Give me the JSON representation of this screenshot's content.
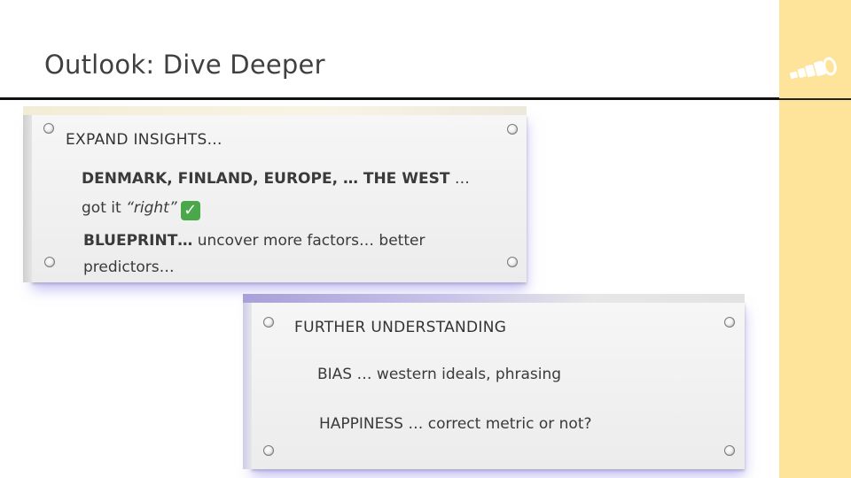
{
  "slide": {
    "title": "Outlook: Dive Deeper"
  },
  "card1": {
    "heading": "EXPAND INSIGHTS…",
    "line1_bold": "DENMARK, FINLAND, EUROPE, … THE WEST",
    "line1_rest": " …",
    "line2_plain": "got it ",
    "line2_italic": "“right”",
    "line2_icon": "check-mark-icon",
    "line3_bold": "BLUEPRINT…",
    "line3_rest": " uncover more factors… better",
    "line4": "predictors…"
  },
  "card2": {
    "heading": "FURTHER UNDERSTANDING",
    "bias_label": "BIAS",
    "bias_rest": " … western ideals, phrasing",
    "happiness_label": "HAPPINESS",
    "happiness_rest": " … correct metric or not?"
  },
  "colors": {
    "side_band": "#fde49a",
    "card_glow": "#9b8fe6",
    "check_green": "#4aa84a"
  }
}
